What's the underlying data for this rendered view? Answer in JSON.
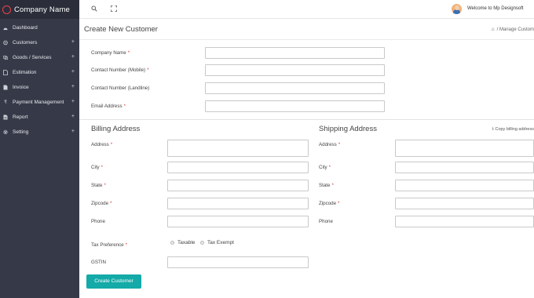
{
  "brand": {
    "name": "Company  Name",
    "accent": "#e8424f"
  },
  "sidebar": {
    "items": [
      {
        "label": "Dashboard",
        "icon": "dashboard-icon",
        "has_plus": false
      },
      {
        "label": "Customers",
        "icon": "customers-icon",
        "has_plus": true
      },
      {
        "label": "Goods / Services",
        "icon": "goods-icon",
        "has_plus": true
      },
      {
        "label": "Estimation",
        "icon": "file-icon",
        "has_plus": true
      },
      {
        "label": "Invoice",
        "icon": "invoice-icon",
        "has_plus": true
      },
      {
        "label": "Payment Management",
        "icon": "rupee-icon",
        "has_plus": true
      },
      {
        "label": "Report",
        "icon": "report-icon",
        "has_plus": true
      },
      {
        "label": "Setting",
        "icon": "gear-icon",
        "has_plus": true
      }
    ],
    "plus": "+"
  },
  "topbar": {
    "welcome": "Welcome to Mp Designsoft"
  },
  "page": {
    "title": "Create New Customer",
    "breadcrumb": "Manage Custom"
  },
  "customer": {
    "company_name": "Company Name",
    "mobile": "Contact Number (Mobile)",
    "landline": "Contact Number (Landline)",
    "email": "Email Address"
  },
  "billing": {
    "title": "Billing Address",
    "address": "Address",
    "city": "City",
    "state": "State",
    "zipcode": "Zipcode",
    "phone": "Phone"
  },
  "shipping": {
    "title": "Shipping Address",
    "copy": "Copy billing address",
    "address": "Address",
    "city": "City",
    "state": "State",
    "zipcode": "Zipcode",
    "phone": "Phone"
  },
  "tax": {
    "label": "Tax Preference",
    "option1": "Taxable",
    "option2": "Tax Exempt",
    "gstin": "GSTIN"
  },
  "required_mark": "*",
  "submit_label": "Create Customer",
  "colors": {
    "button": "#13aaa8",
    "sidebar": "#363a48",
    "required": "#e23b3b"
  }
}
